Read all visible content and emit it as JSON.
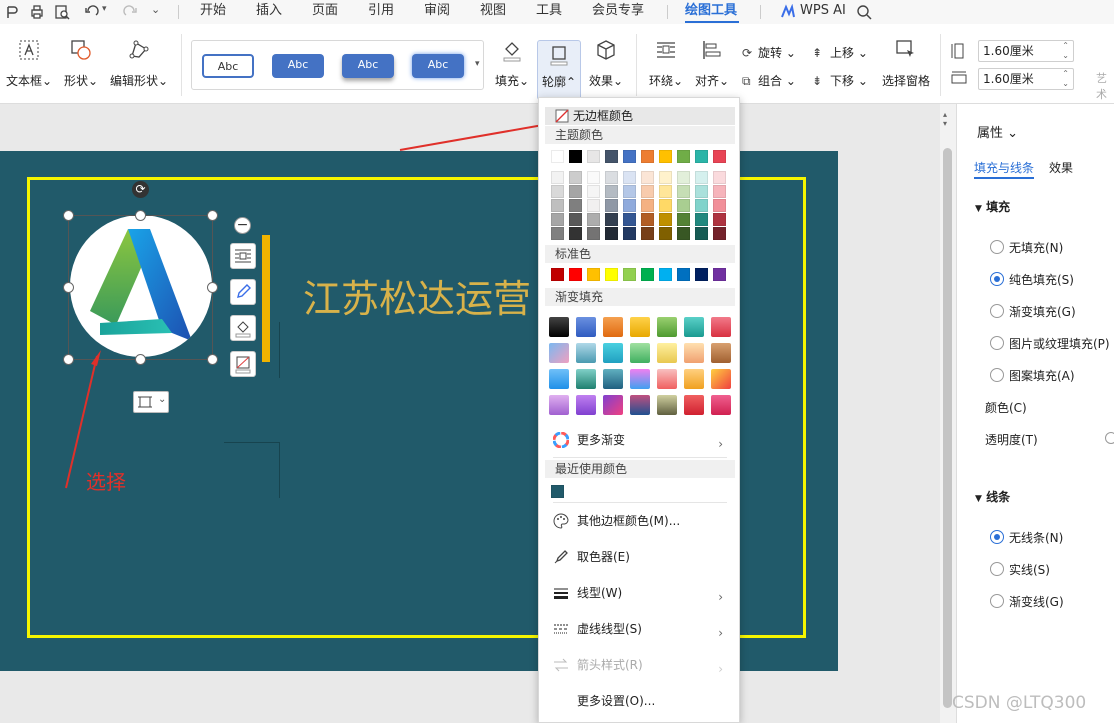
{
  "menu": {
    "items": [
      "开始",
      "插入",
      "页面",
      "引用",
      "审阅",
      "视图",
      "工具",
      "会员专享",
      "绘图工具"
    ],
    "active": "绘图工具",
    "ai_label": "WPS AI"
  },
  "ribbon": {
    "textbox": "文本框",
    "shape": "形状",
    "edit_shape": "编辑形状",
    "style_samples": [
      "Abc",
      "Abc",
      "Abc",
      "Abc"
    ],
    "fill": "填充",
    "outline": "轮廓",
    "effect": "效果",
    "wrap": "环绕",
    "align": "对齐",
    "rotate": "旋转",
    "group": "组合",
    "bring_forward": "上移",
    "send_backward": "下移",
    "selection_pane": "选择窗格",
    "height_value": "1.60厘米",
    "width_value": "1.60厘米",
    "art_label": "艺术"
  },
  "slide": {
    "title_text": "江苏松达运营",
    "annotation_label": "选择",
    "frame_color": "#f5f500",
    "background_color": "#215a6a"
  },
  "outline_menu": {
    "no_border": "无边框颜色",
    "theme_colors_title": "主题颜色",
    "theme_row": [
      "#ffffff",
      "#000000",
      "#e7e6e6",
      "#44546a",
      "#4472c4",
      "#ed7d31",
      "#ffc000",
      "#70ad47",
      "#2bb5a8",
      "#e84455"
    ],
    "standard_title": "标准色",
    "standard_colors": [
      "#c00000",
      "#ff0000",
      "#ffc000",
      "#ffff00",
      "#92d050",
      "#00b050",
      "#00b0f0",
      "#0070c0",
      "#002060",
      "#7030a0"
    ],
    "gradient_title": "渐变填充",
    "more_gradient": "更多渐变",
    "recent_title": "最近使用颜色",
    "recent_colors": [
      "#215a6a"
    ],
    "other_border_color": "其他边框颜色(M)...",
    "eyedropper": "取色器(E)",
    "line_type": "线型(W)",
    "dash_type": "虚线线型(S)",
    "arrow_style": "箭头样式(R)",
    "more_settings": "更多设置(O)..."
  },
  "properties_panel": {
    "title": "属性",
    "tab_fill_line": "填充与线条",
    "tab_effect": "效果",
    "fill_section": "填充",
    "fill_options": [
      "无填充(N)",
      "纯色填充(S)",
      "渐变填充(G)",
      "图片或纹理填充(P)",
      "图案填充(A)"
    ],
    "fill_selected": "纯色填充(S)",
    "color_label": "颜色(C)",
    "transparency_label": "透明度(T)",
    "line_section": "线条",
    "line_options": [
      "无线条(N)",
      "实线(S)",
      "渐变线(G)"
    ],
    "line_selected": "无线条(N)"
  },
  "watermark": "CSDN @LTQ300"
}
